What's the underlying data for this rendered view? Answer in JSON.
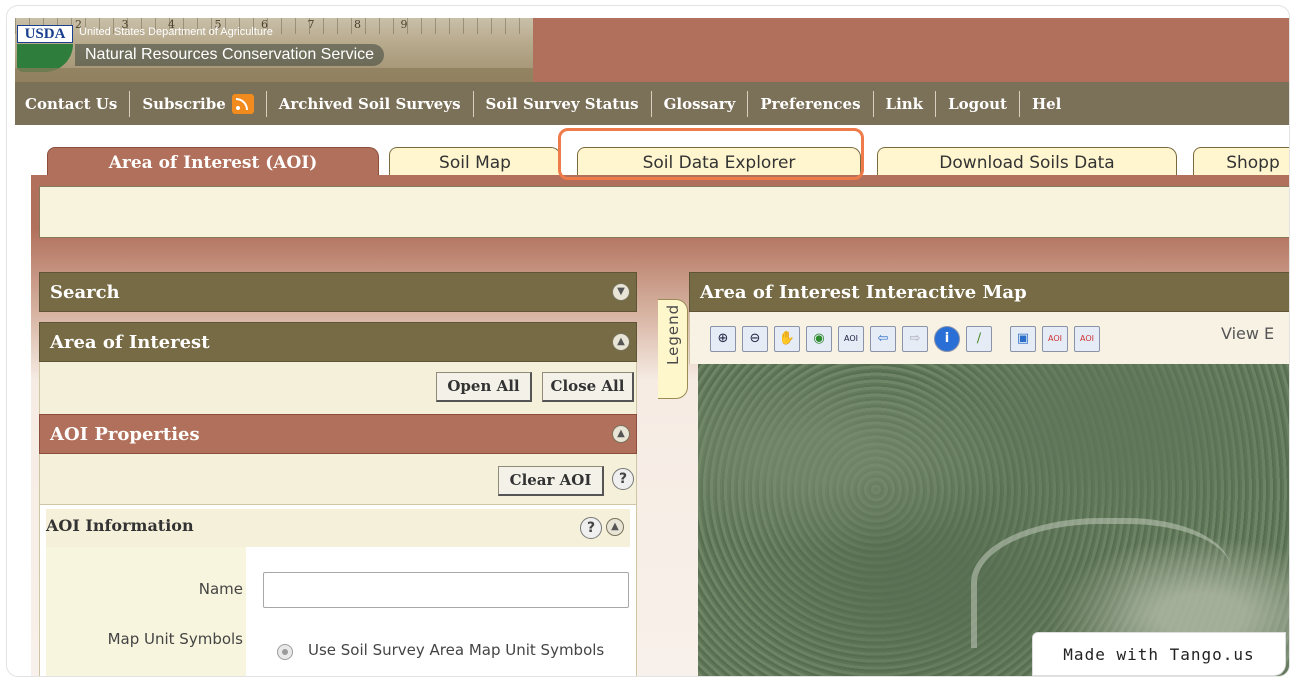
{
  "header": {
    "logo_mark": "USDA",
    "department": "United States Department of Agriculture",
    "agency": "Natural Resources Conservation Service",
    "ruler_numbers": "2 3 4 5 6 7 8 9"
  },
  "nav": {
    "items": [
      {
        "label": "Contact Us"
      },
      {
        "label": "Subscribe",
        "icon": "rss-icon"
      },
      {
        "label": "Archived Soil Surveys"
      },
      {
        "label": "Soil Survey Status"
      },
      {
        "label": "Glossary"
      },
      {
        "label": "Preferences"
      },
      {
        "label": "Link"
      },
      {
        "label": "Logout"
      },
      {
        "label": "Hel"
      }
    ]
  },
  "tabs": [
    {
      "label": "Area of Interest (AOI)",
      "active": true
    },
    {
      "label": "Soil Map",
      "active": false
    },
    {
      "label": "Soil Data Explorer",
      "active": false,
      "highlighted": true
    },
    {
      "label": "Download Soils Data",
      "active": false
    },
    {
      "label": "Shopp",
      "active": false
    }
  ],
  "left_panel": {
    "search_title": "Search",
    "aoi_title": "Area of Interest",
    "open_all": "Open All",
    "close_all": "Close All",
    "aoi_properties_title": "AOI Properties",
    "clear_aoi": "Clear AOI",
    "aoi_info_title": "AOI Information",
    "name_label": "Name",
    "name_value": "",
    "map_unit_label": "Map Unit Symbols",
    "map_unit_option": "Use Soil Survey Area Map Unit Symbols"
  },
  "legend": {
    "label": "Legend"
  },
  "map": {
    "title": "Area of Interest Interactive Map",
    "view_extent_label": "View E",
    "tools": [
      {
        "icon": "zoom-in-icon",
        "glyph": "⊕"
      },
      {
        "icon": "zoom-out-icon",
        "glyph": "⊖"
      },
      {
        "icon": "pan-hand-icon",
        "glyph": "✋"
      },
      {
        "icon": "globe-icon",
        "glyph": "◉"
      },
      {
        "icon": "aoi-point-icon",
        "glyph": "AOI"
      },
      {
        "icon": "back-arrow-icon",
        "glyph": "⇦"
      },
      {
        "icon": "forward-arrow-icon",
        "glyph": "⇨"
      },
      {
        "icon": "info-icon",
        "glyph": "i"
      },
      {
        "icon": "measure-icon",
        "glyph": "∕"
      },
      {
        "icon": "select-icon",
        "glyph": "▣"
      },
      {
        "icon": "aoi-rectangle-icon",
        "glyph": "AOI"
      },
      {
        "icon": "aoi-polygon-icon",
        "glyph": "AOI"
      }
    ]
  },
  "watermark": "Made with Tango.us",
  "colors": {
    "header_rust": "#b1705b",
    "nav_olive": "#7b7058",
    "tab_cream": "#fff5cf",
    "highlight_orange": "#ef7a4a"
  }
}
